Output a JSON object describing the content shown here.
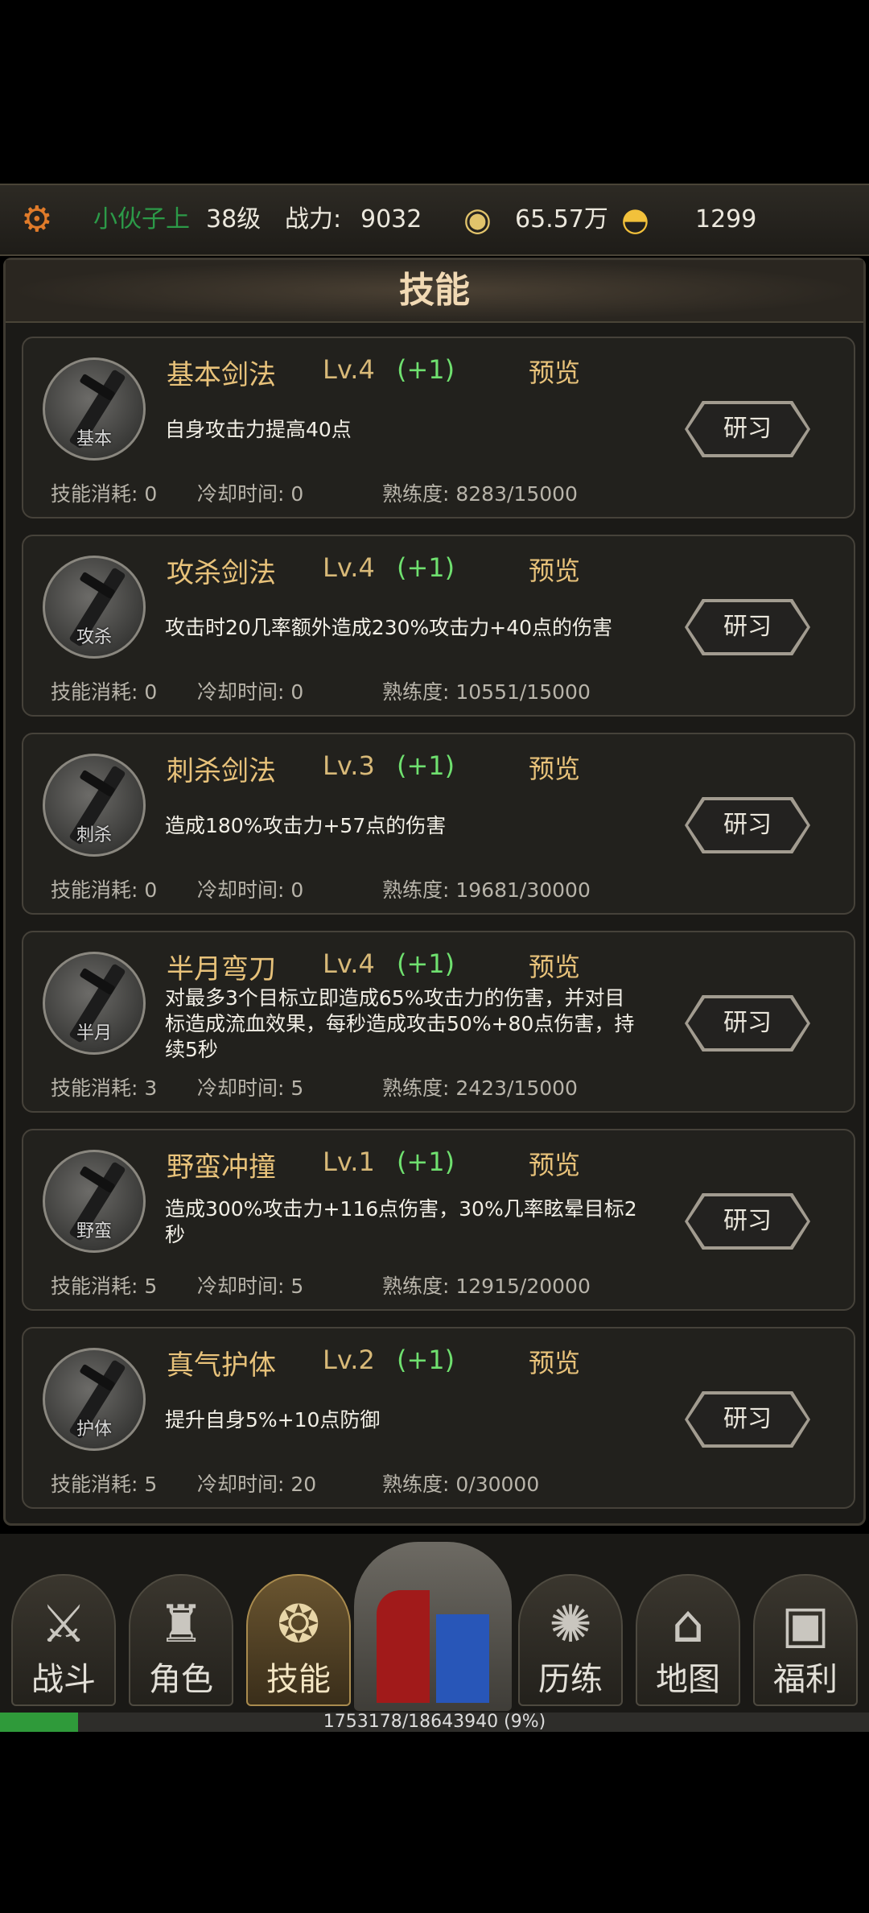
{
  "topbar": {
    "player_name": "小伙子上",
    "level": "38级",
    "power_label": "战力:",
    "power_value": "9032",
    "coins": "65.57万",
    "ingots": "1299"
  },
  "panel": {
    "title": "技能"
  },
  "skills": [
    {
      "icon_caption": "基本",
      "name": "基本剑法",
      "level": "Lv.4",
      "bonus": "(+1)",
      "preview": "预览",
      "desc": "自身攻击力提高40点",
      "cost": "技能消耗: 0",
      "cooldown": "冷却时间: 0",
      "mastery": "熟练度: 8283/15000",
      "study": "研习"
    },
    {
      "icon_caption": "攻杀",
      "name": "攻杀剑法",
      "level": "Lv.4",
      "bonus": "(+1)",
      "preview": "预览",
      "desc": "攻击时20几率额外造成230%攻击力+40点的伤害",
      "cost": "技能消耗: 0",
      "cooldown": "冷却时间: 0",
      "mastery": "熟练度: 10551/15000",
      "study": "研习"
    },
    {
      "icon_caption": "刺杀",
      "name": "刺杀剑法",
      "level": "Lv.3",
      "bonus": "(+1)",
      "preview": "预览",
      "desc": "造成180%攻击力+57点的伤害",
      "cost": "技能消耗: 0",
      "cooldown": "冷却时间: 0",
      "mastery": "熟练度: 19681/30000",
      "study": "研习"
    },
    {
      "icon_caption": "半月",
      "name": "半月弯刀",
      "level": "Lv.4",
      "bonus": "(+1)",
      "preview": "预览",
      "desc": "对最多3个目标立即造成65%攻击力的伤害，并对目标造成流血效果，每秒造成攻击50%+80点伤害，持续5秒",
      "cost": "技能消耗: 3",
      "cooldown": "冷却时间: 5",
      "mastery": "熟练度: 2423/15000",
      "study": "研习"
    },
    {
      "icon_caption": "野蛮",
      "name": "野蛮冲撞",
      "level": "Lv.1",
      "bonus": "(+1)",
      "preview": "预览",
      "desc": "造成300%攻击力+116点伤害，30%几率眩晕目标2秒",
      "cost": "技能消耗: 5",
      "cooldown": "冷却时间: 5",
      "mastery": "熟练度: 12915/20000",
      "study": "研习"
    },
    {
      "icon_caption": "护体",
      "name": "真气护体",
      "level": "Lv.2",
      "bonus": "(+1)",
      "preview": "预览",
      "desc": "提升自身5%+10点防御",
      "cost": "技能消耗: 5",
      "cooldown": "冷却时间: 20",
      "mastery": "熟练度: 0/30000",
      "study": "研习"
    }
  ],
  "nav": {
    "battle": "战斗",
    "role": "角色",
    "skill": "技能",
    "training": "历练",
    "map": "地图",
    "welfare": "福利"
  },
  "xp": {
    "text": "1753178/18643940 (9%)",
    "progress": 0.09
  }
}
